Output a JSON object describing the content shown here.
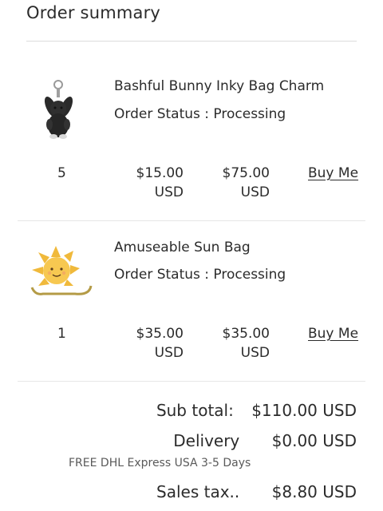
{
  "header": {
    "title": "Order summary"
  },
  "items": [
    {
      "name": "Bashful Bunny Inky Bag Charm",
      "status": "Order Status : Processing",
      "quantity": "5",
      "unit_price": "$15.00",
      "unit_currency": "USD",
      "total_price": "$75.00",
      "total_currency": "USD",
      "buy_label": "Buy Me",
      "image": "black-bunny-bag-charm"
    },
    {
      "name": "Amuseable Sun Bag",
      "status": "Order Status : Processing",
      "quantity": "1",
      "unit_price": "$35.00",
      "unit_currency": "USD",
      "total_price": "$35.00",
      "total_currency": "USD",
      "buy_label": "Buy Me",
      "image": "yellow-sun-bag"
    }
  ],
  "summary": {
    "subtotal_label": "Sub total:",
    "subtotal_value": "$110.00 USD",
    "delivery_label": "Delivery",
    "delivery_value": "$0.00 USD",
    "delivery_note": "FREE DHL Express USA 3-5 Days",
    "tax_label": "Sales tax..",
    "tax_value": "$8.80 USD"
  },
  "colors": {
    "text": "#2b2b2b",
    "divider": "#dcdcdc",
    "sun_yellow": "#f2c14e"
  }
}
